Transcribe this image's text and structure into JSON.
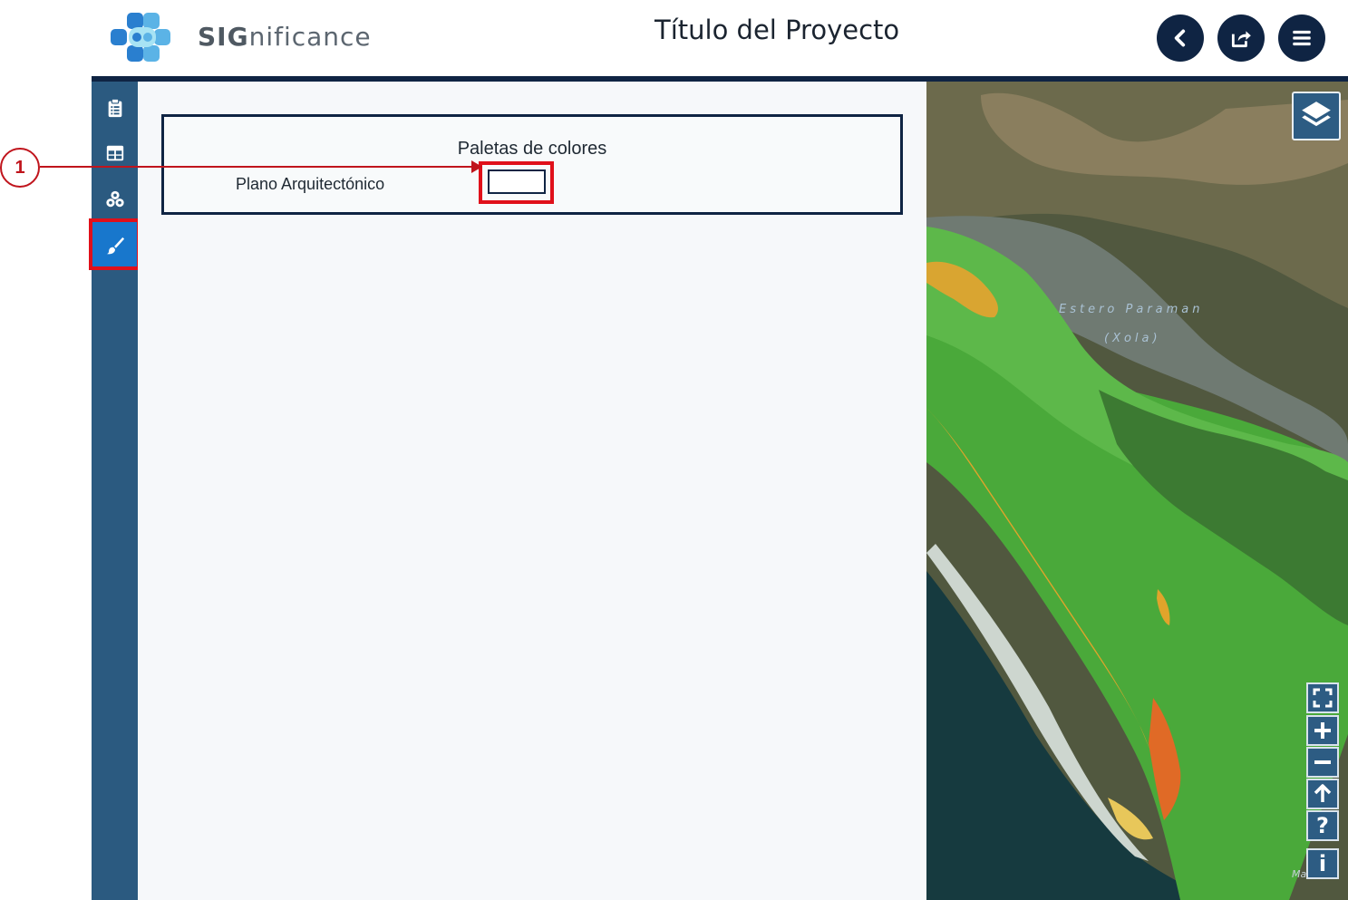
{
  "app": {
    "brand_prefix": "SIG",
    "brand_suffix": "nificance",
    "page_title": "Título del Proyecto"
  },
  "header_buttons": [
    {
      "name": "back",
      "icon": "chevron-left-icon"
    },
    {
      "name": "share",
      "icon": "share-icon"
    },
    {
      "name": "menu",
      "icon": "hamburger-menu-icon"
    }
  ],
  "sidebar": {
    "items": [
      {
        "icon": "clipboard-icon",
        "active": false
      },
      {
        "icon": "table-icon",
        "active": false
      },
      {
        "icon": "layers-cluster-icon",
        "active": false
      },
      {
        "icon": "paint-brush-icon",
        "active": true
      }
    ]
  },
  "palette_panel": {
    "title": "Paletas de colores",
    "rows": [
      {
        "label": "Plano Arquitectónico",
        "swatch_color": "#ffffff"
      }
    ]
  },
  "annotation": {
    "callout_number": "1"
  },
  "map": {
    "labels": {
      "estero": "Estero Paraman",
      "xola": "(Xola)",
      "corner": "Marana"
    },
    "controls": [
      {
        "name": "fullscreen",
        "icon": "fullscreen-icon"
      },
      {
        "name": "zoom-in",
        "icon": "plus-icon"
      },
      {
        "name": "zoom-out",
        "icon": "minus-icon"
      },
      {
        "name": "north",
        "icon": "arrow-up-icon"
      },
      {
        "name": "help",
        "symbol": "?"
      },
      {
        "name": "info",
        "symbol": "i"
      }
    ]
  },
  "colors": {
    "navy": "#0f2443",
    "sidebar": "#2b5a80",
    "active": "#1877cc",
    "highlight": "#e0101a"
  }
}
